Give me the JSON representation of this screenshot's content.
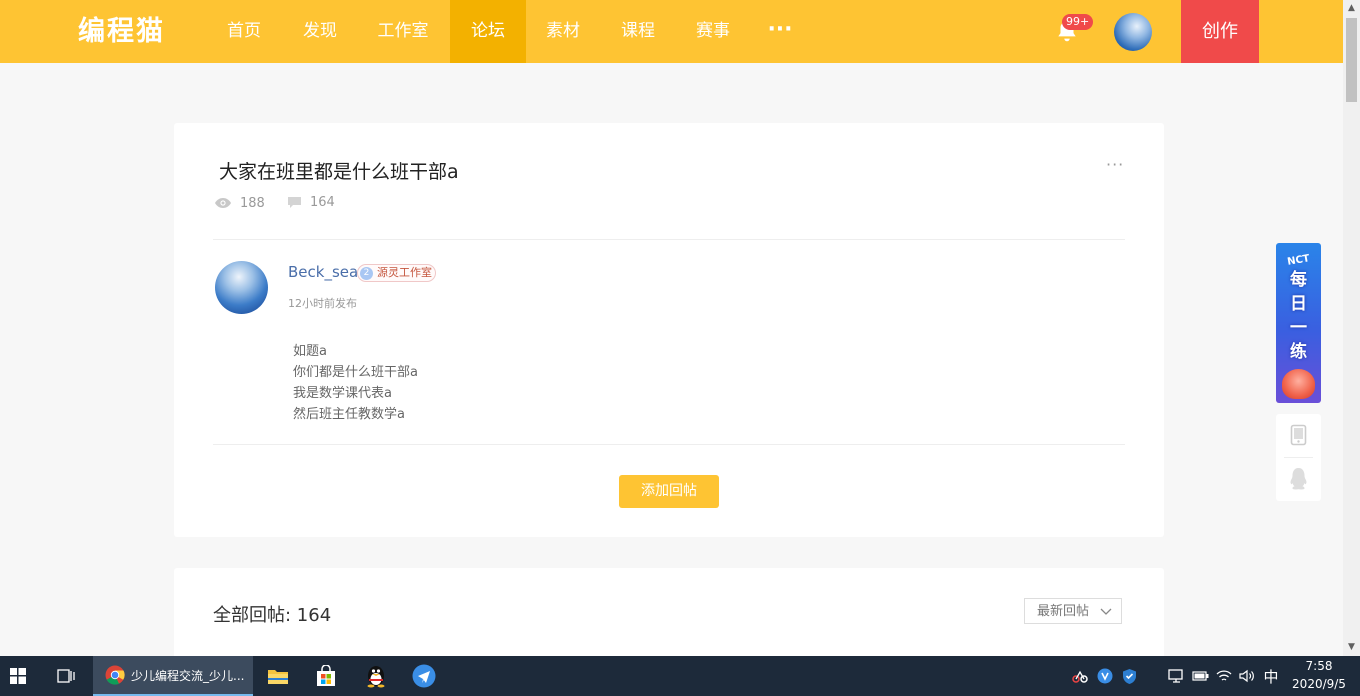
{
  "nav": {
    "logo": "编程猫",
    "items": [
      {
        "label": "首页",
        "active": false
      },
      {
        "label": "发现",
        "active": false
      },
      {
        "label": "工作室",
        "active": false
      },
      {
        "label": "论坛",
        "active": true
      },
      {
        "label": "素材",
        "active": false
      },
      {
        "label": "课程",
        "active": false
      },
      {
        "label": "赛事",
        "active": false
      }
    ],
    "more": "···",
    "notification_badge": "99+",
    "create_label": "创作"
  },
  "post": {
    "title": "大家在班里都是什么班干部a",
    "views": "188",
    "comments": "164",
    "author": "Beck_sea",
    "studio_level": "2",
    "studio": "源灵工作室",
    "time": "12小时前发布",
    "content": [
      "如题a",
      "你们都是什么班干部a",
      "我是数学课代表a",
      "然后班主任教数学a"
    ],
    "reply_button": "添加回帖"
  },
  "replies": {
    "title": "全部回帖: 164",
    "sort": "最新回帖"
  },
  "side": {
    "banner_top": "NCT",
    "banner_text": [
      "每",
      "日",
      "一",
      "练"
    ]
  },
  "taskbar": {
    "chrome_title": "少儿编程交流_少儿...",
    "ime": "中",
    "time": "7:58",
    "date": "2020/9/5"
  },
  "colors": {
    "brand": "#fec433",
    "nav_active": "#f3b100",
    "create": "#f04a4a",
    "author_link": "#4a6ea9"
  }
}
